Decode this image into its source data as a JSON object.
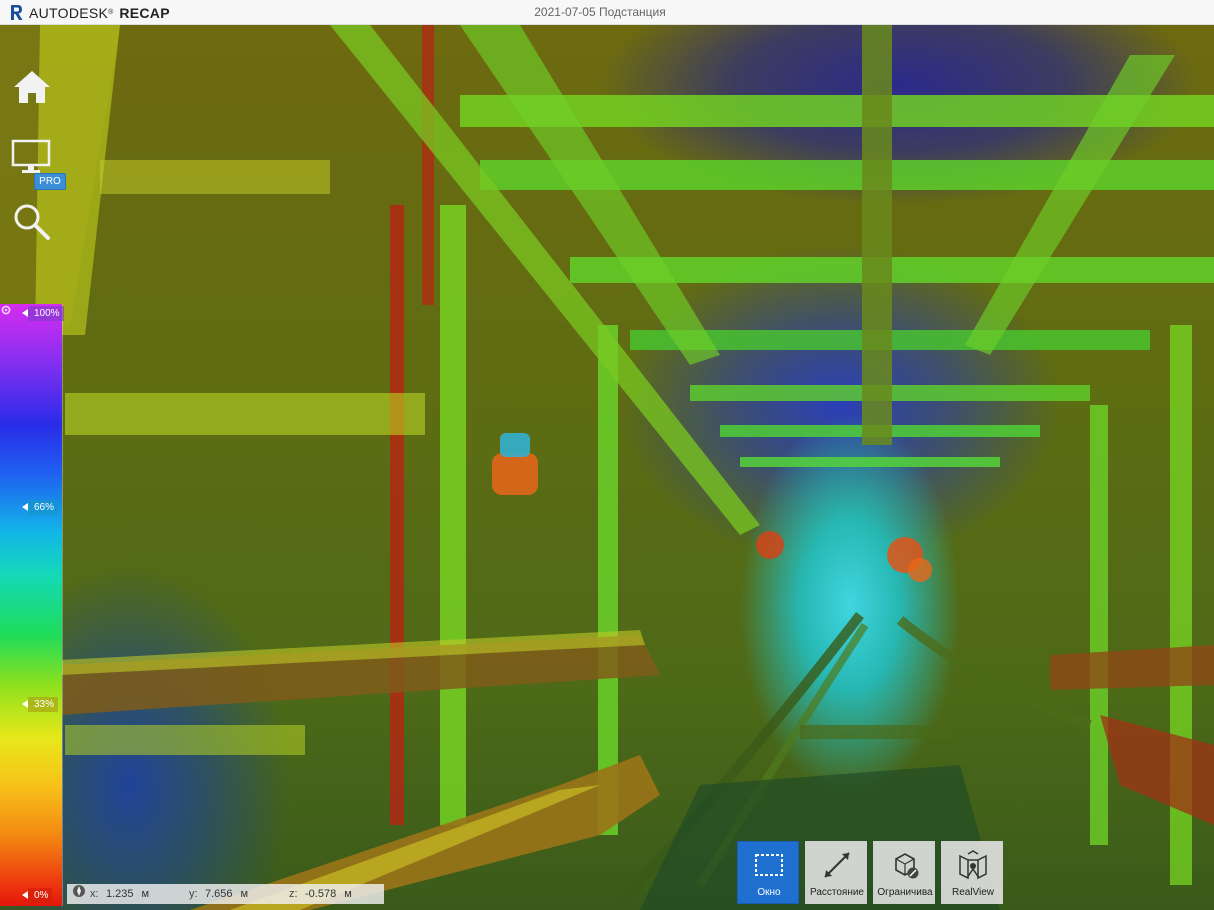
{
  "app": {
    "brand_name": "AUTODESK",
    "brand_trademark": "®",
    "product": "RECAP",
    "document_title": "2021-07-05 Подстанция"
  },
  "nav": {
    "icons": [
      "home-icon",
      "display-icon",
      "search-icon"
    ],
    "pro_badge": "PRO"
  },
  "color_scale": {
    "labels": [
      "100%",
      "66%",
      "33%",
      "0%"
    ],
    "gradient_colors": [
      "#d62cf0",
      "#2a2ce8",
      "#13b6e8",
      "#1fdc5a",
      "#e6e81a",
      "#f38b12",
      "#e3160b"
    ]
  },
  "coordinates": {
    "x_label": "x:",
    "x_value": "1.235",
    "x_unit": "м",
    "y_label": "y:",
    "y_value": "7.656",
    "y_unit": "м",
    "z_label": "z:",
    "z_value": "-0.578",
    "z_unit": "м"
  },
  "tools": {
    "window": {
      "label": "Окно",
      "active": true
    },
    "distance": {
      "label": "Расстояние"
    },
    "limit": {
      "label": "Ограничива"
    },
    "realview": {
      "label": "RealView"
    }
  },
  "colors": {
    "accent": "#1f6fd1",
    "pro_badge": "#3a8fd8",
    "title_bar": "#f7f7f7",
    "brand_r": "#1b4f9c"
  }
}
